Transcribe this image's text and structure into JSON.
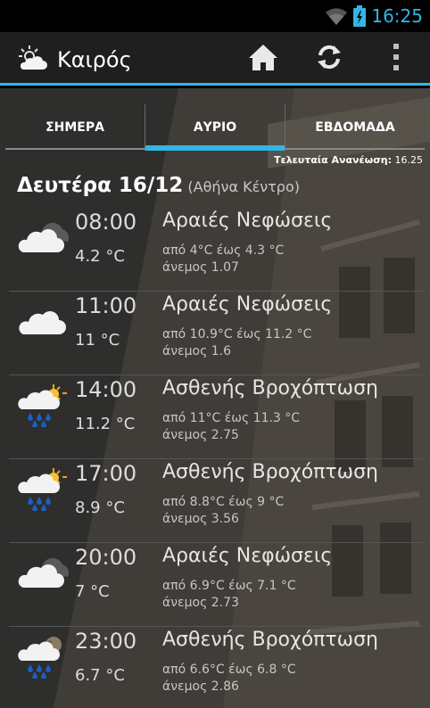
{
  "status_bar": {
    "time": "16:25",
    "wifi_icon": "wifi-icon",
    "battery_icon": "battery-icon"
  },
  "app": {
    "title": "Καιρός",
    "icon": "partly-cloudy-app-icon"
  },
  "actions": {
    "home_icon": "home-icon",
    "refresh_icon": "refresh-icon",
    "overflow_icon": "overflow-menu-icon"
  },
  "tabs": [
    {
      "label": "ΣΗΜΕΡΑ",
      "selected": false
    },
    {
      "label": "ΑΥΡΙΟ",
      "selected": true
    },
    {
      "label": "ΕΒΔΟΜΑΔΑ",
      "selected": false
    }
  ],
  "last_update": {
    "label": "Τελευταία Ανανέωση:",
    "time": "16.25"
  },
  "day": {
    "title": "Δευτέρα 16/12",
    "location": "(Αθήνα Κέντρο)"
  },
  "forecast": [
    {
      "time": "08:00",
      "temp": "4.2 °C",
      "description": "Αραιές Νεφώσεις",
      "range": "από 4°C έως 4.3 °C",
      "wind": "άνεμος 1.07",
      "icon": "cloudy-night-icon"
    },
    {
      "time": "11:00",
      "temp": "11 °C",
      "description": "Αραιές Νεφώσεις",
      "range": "από 10.9°C έως 11.2 °C",
      "wind": "άνεμος 1.6",
      "icon": "cloud-icon"
    },
    {
      "time": "14:00",
      "temp": "11.2 °C",
      "description": "Ασθενής Βροχόπτωση",
      "range": "από 11°C έως 11.3 °C",
      "wind": "άνεμος 2.75",
      "icon": "rain-sun-icon"
    },
    {
      "time": "17:00",
      "temp": "8.9 °C",
      "description": "Ασθενής Βροχόπτωση",
      "range": "από 8.8°C έως 9 °C",
      "wind": "άνεμος 3.56",
      "icon": "rain-sun-icon"
    },
    {
      "time": "20:00",
      "temp": "7 °C",
      "description": "Αραιές Νεφώσεις",
      "range": "από 6.9°C έως 7.1 °C",
      "wind": "άνεμος 2.73",
      "icon": "cloudy-night-icon"
    },
    {
      "time": "23:00",
      "temp": "6.7 °C",
      "description": "Ασθενής Βροχόπτωση",
      "range": "από 6.6°C έως 6.8 °C",
      "wind": "άνεμος 2.86",
      "icon": "rain-moon-icon"
    }
  ],
  "colors": {
    "accent": "#33b5e5",
    "action_bar": "#1f1f1f",
    "background": "#2e2e2d"
  }
}
